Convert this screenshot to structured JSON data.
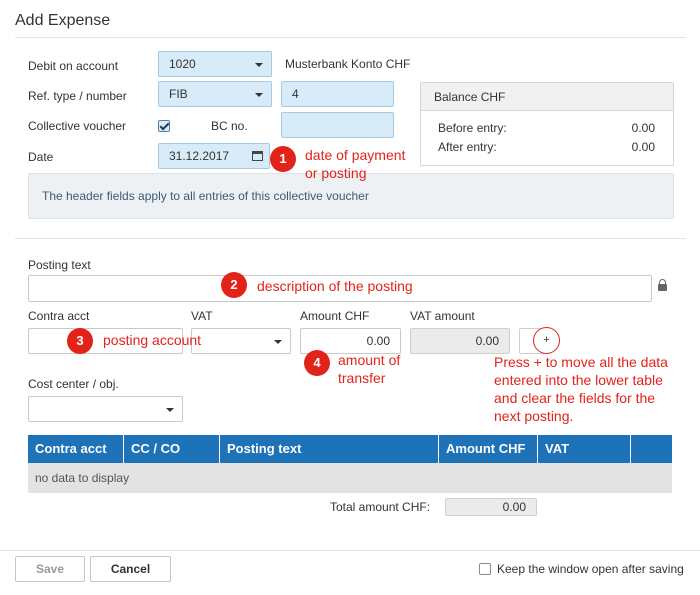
{
  "dialog": {
    "title": "Add Expense"
  },
  "header": {
    "debit_label": "Debit on account",
    "debit_value": "1020",
    "debit_name": "Musterbank Konto CHF",
    "ref_label": "Ref. type / number",
    "ref_type": "FIB",
    "ref_number": "4",
    "collective_label": "Collective voucher",
    "collective_checked": true,
    "bc_label": "BC no.",
    "bc_value": "",
    "date_label": "Date",
    "date_value": "31.12.2017",
    "info": "The header fields apply to all entries of this collective voucher"
  },
  "balance": {
    "title": "Balance CHF",
    "before_label": "Before entry:",
    "before_value": "0.00",
    "after_label": "After entry:",
    "after_value": "0.00"
  },
  "entry": {
    "posting_text_label": "Posting text",
    "posting_text_value": "",
    "contra_label": "Contra acct",
    "contra_value": "",
    "vat_label": "VAT",
    "vat_value": "",
    "amount_label": "Amount CHF",
    "amount_value": "0.00",
    "vat_amount_label": "VAT amount",
    "vat_amount_value": "0.00",
    "add_label": "+",
    "cost_center_label": "Cost center / obj.",
    "cost_center_value": ""
  },
  "grid": {
    "columns": [
      "Contra acct",
      "CC / CO",
      "Posting text",
      "Amount CHF",
      "VAT",
      ""
    ],
    "empty_text": "no data to display",
    "total_label": "Total amount CHF:",
    "total_value": "0.00"
  },
  "footer": {
    "save_label": "Save",
    "cancel_label": "Cancel",
    "keep_open_label": "Keep the window open after saving"
  },
  "annotations": {
    "a1_num": "1",
    "a1_line1": "date of payment",
    "a1_line2": "or posting",
    "a2_num": "2",
    "a2_text": "description of the posting",
    "a3_num": "3",
    "a3_text": "posting account",
    "a4_num": "4",
    "a4_line1": "amount of",
    "a4_line2": "transfer",
    "note_line1": "Press + to move all the data",
    "note_line2": "entered into the lower table",
    "note_line3": "and clear the fields for the",
    "note_line4": "next posting."
  },
  "colors": {
    "annotation_red": "#e2231a",
    "grid_header_blue": "#1e72b8",
    "field_blue": "#d8ebf8"
  }
}
